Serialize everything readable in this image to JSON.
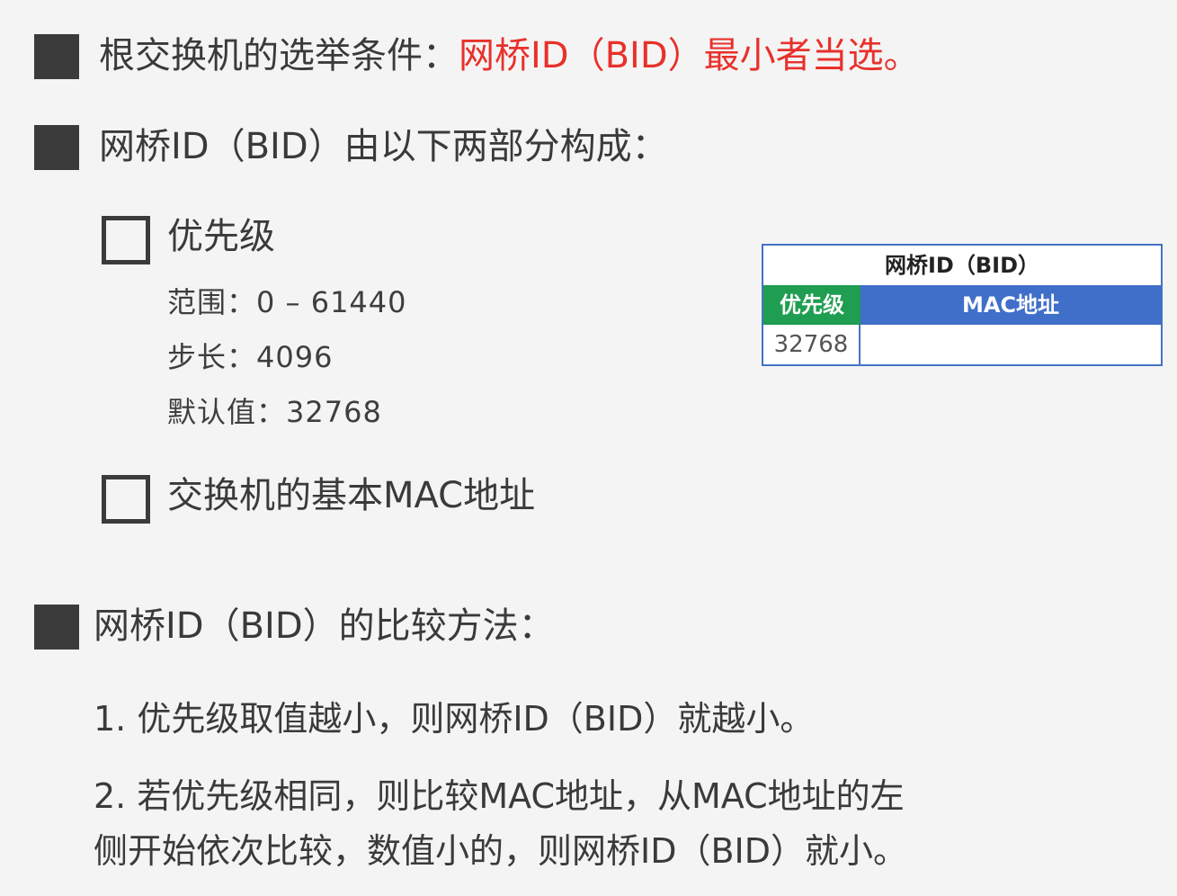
{
  "section1": {
    "prefix": "根交换机的选举条件：",
    "highlight": "网桥ID（BID）最小者当选。"
  },
  "section2": {
    "heading": "网桥ID（BID）由以下两部分构成："
  },
  "priority": {
    "label": "优先级",
    "range": "范围：0 – 61440",
    "step": "步长：4096",
    "default": "默认值：32768"
  },
  "mac": {
    "label": "交换机的基本MAC地址"
  },
  "bid_table": {
    "title": "网桥ID（BID）",
    "priority_header": "优先级",
    "mac_header": "MAC地址",
    "priority_value": "32768",
    "mac_value": ""
  },
  "section3": {
    "heading": "网桥ID（BID）的比较方法：",
    "rule1": "1. 优先级取值越小，则网桥ID（BID）就越小。",
    "rule2_line1": "2. 若优先级相同，则比较MAC地址，从MAC地址的左",
    "rule2_line2": "侧开始依次比较，数值小的，则网桥ID（BID）就小。"
  },
  "colors": {
    "highlight_red": "#e8312b",
    "priority_green": "#1f9d50",
    "mac_blue": "#3f6fc9",
    "table_border": "#4472c4"
  },
  "icons": [
    "filled-square-bullet",
    "empty-square-bullet"
  ]
}
